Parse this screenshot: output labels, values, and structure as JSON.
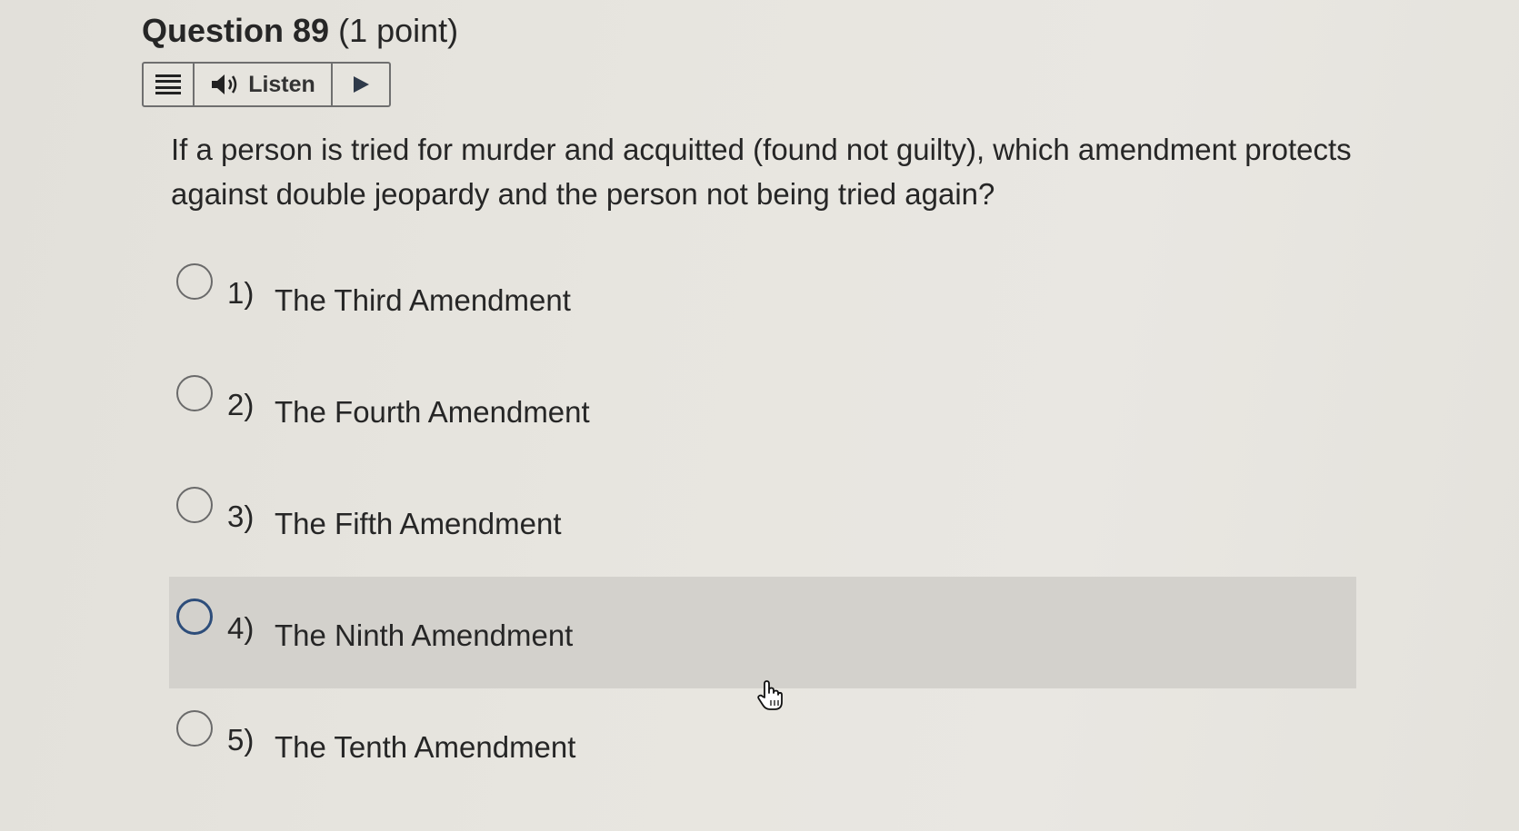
{
  "question": {
    "title": "Question 89",
    "points": "(1 point)",
    "text": "If a person is tried for murder and acquitted (found not guilty), which amendment protects against double jeopardy and the person not being tried again?"
  },
  "listen_bar": {
    "menu_icon": "hamburger-menu-icon",
    "speaker_icon": "speaker-icon",
    "listen_label": "Listen",
    "play_icon": "play-icon"
  },
  "options": [
    {
      "number": "1)",
      "label": "The Third Amendment",
      "highlighted": false
    },
    {
      "number": "2)",
      "label": "The Fourth Amendment",
      "highlighted": false
    },
    {
      "number": "3)",
      "label": "The Fifth Amendment",
      "highlighted": false
    },
    {
      "number": "4)",
      "label": "The Ninth Amendment",
      "highlighted": true
    },
    {
      "number": "5)",
      "label": "The Tenth Amendment",
      "highlighted": false
    }
  ],
  "colors": {
    "highlight_background": "#d3d1cc",
    "highlight_radio": "#2d4d7a",
    "play_triangle": "#2f3a4a"
  },
  "cursor_icon": "pointer-hand-icon"
}
